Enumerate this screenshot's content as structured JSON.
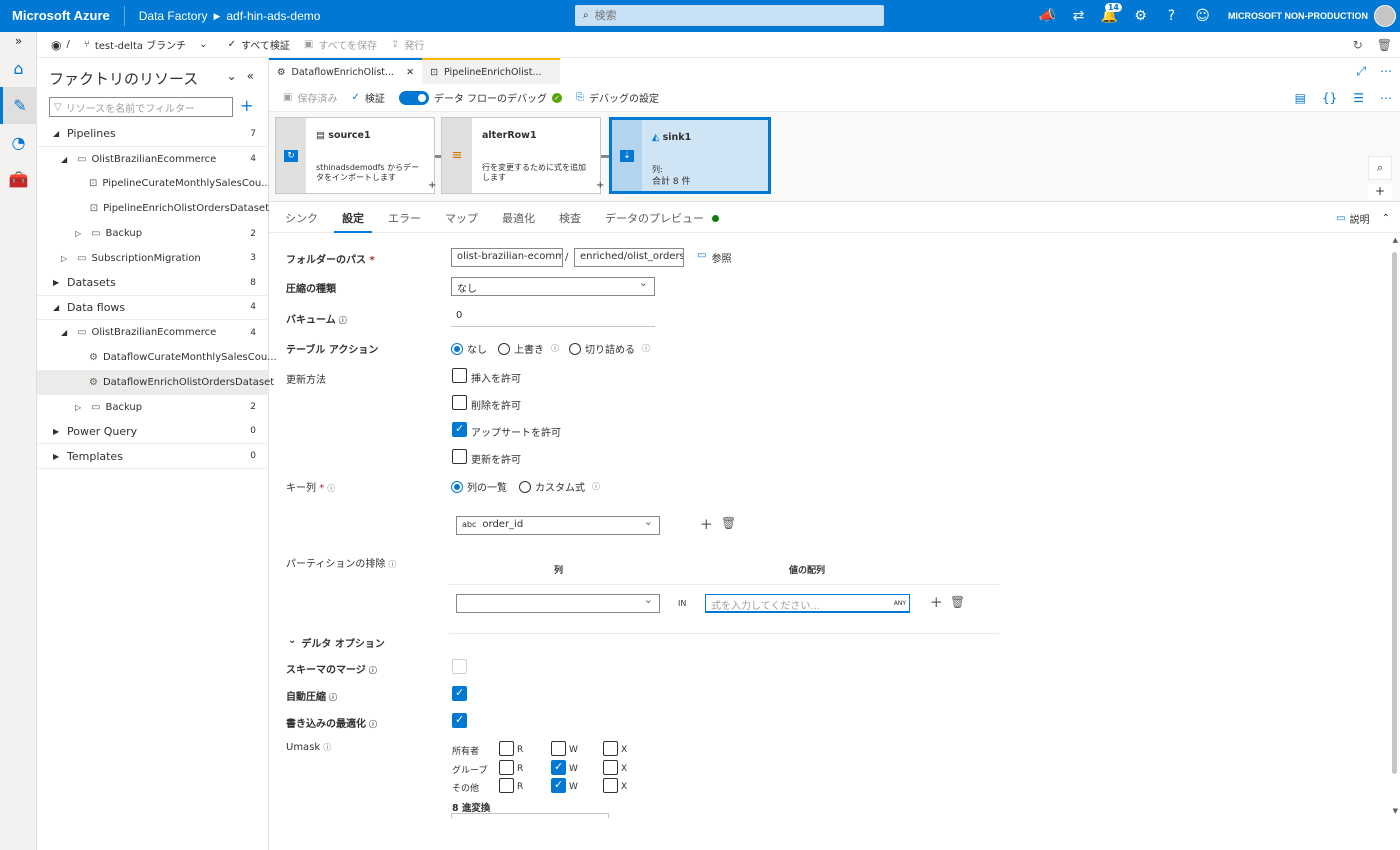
{
  "topbar": {
    "brand": "Microsoft Azure",
    "service": "Data Factory",
    "factory": "adf-hin-ads-demo",
    "search_placeholder": "検索",
    "notifications_count": "14",
    "account": "MICROSOFT NON-PRODUCTION"
  },
  "gitbar": {
    "sep": "/",
    "branch": "test-delta ブランチ",
    "validate_all": "すべて検証",
    "save_all": "すべてを保存",
    "publish": "発行"
  },
  "resources": {
    "title": "ファクトリのリソース",
    "filter_placeholder": "リソースを名前でフィルター",
    "tree": [
      {
        "label": "Pipelines",
        "count": "7",
        "kind": "top"
      },
      {
        "label": "OlistBrazilianEcommerce",
        "count": "4",
        "kind": "folder"
      },
      {
        "label": "PipelineCurateMonthlySalesCou...",
        "count": "",
        "kind": "pipeline"
      },
      {
        "label": "PipelineEnrichOlistOrdersDataset",
        "count": "",
        "kind": "pipeline"
      },
      {
        "label": "Backup",
        "count": "2",
        "kind": "subfolder"
      },
      {
        "label": "SubscriptionMigration",
        "count": "3",
        "kind": "folder2"
      },
      {
        "label": "Datasets",
        "count": "8",
        "kind": "top"
      },
      {
        "label": "Data flows",
        "count": "4",
        "kind": "top"
      },
      {
        "label": "OlistBrazilianEcommerce",
        "count": "4",
        "kind": "folder"
      },
      {
        "label": "DataflowCurateMonthlySalesCou...",
        "count": "",
        "kind": "dataflow"
      },
      {
        "label": "DataflowEnrichOlistOrdersDataset",
        "count": "",
        "kind": "dataflow-sel"
      },
      {
        "label": "Backup",
        "count": "2",
        "kind": "subfolder"
      },
      {
        "label": "Power Query",
        "count": "0",
        "kind": "top"
      },
      {
        "label": "Templates",
        "count": "0",
        "kind": "top"
      }
    ]
  },
  "editor": {
    "tab_active": "DataflowEnrichOlist...",
    "tab_inactive": "PipelineEnrichOlist...",
    "saved": "保存済み",
    "validate": "検証",
    "debug": "データ フローのデバッグ",
    "debug_settings": "デバッグの設定"
  },
  "canvas": {
    "nodes": [
      {
        "name": "source1",
        "desc": "sthinadsdemodfs からデータをインポートします"
      },
      {
        "name": "alterRow1",
        "desc": "行を変更するために式を追加します"
      },
      {
        "name": "sink1",
        "desc": "列:",
        "desc2": "合計 8 件"
      }
    ]
  },
  "settings_tabs": [
    "シンク",
    "設定",
    "エラー",
    "マップ",
    "最適化",
    "検査",
    "データのプレビュー"
  ],
  "settings_tabs_right": {
    "explain": "説明"
  },
  "form": {
    "folder_path_label": "フォルダーのパス",
    "folder_path_1": "olist-brazilian-ecomm",
    "folder_path_sep": "/",
    "folder_path_2": "enriched/olist_orders_",
    "browse": "参照",
    "compression_label": "圧縮の種類",
    "compression_value": "なし",
    "vacuum_label": "バキューム",
    "vacuum_value": "0",
    "table_action_label": "テーブル アクション",
    "table_action_options": [
      "なし",
      "上書き",
      "切り詰める"
    ],
    "update_method_label": "更新方法",
    "update_options": [
      "挿入を許可",
      "削除を許可",
      "アップサートを許可",
      "更新を許可"
    ],
    "key_columns_label": "キー列",
    "key_column_options": [
      "列の一覧",
      "カスタム式"
    ],
    "key_column_type": "abc",
    "key_column_value": "order_id",
    "partition_label": "パーティションの排除",
    "partition_col_header": "列",
    "partition_val_header": "値の配列",
    "partition_in": "IN",
    "partition_placeholder": "式を入力してください...",
    "partition_any": "ANY",
    "delta_options": "デルタ オプション",
    "merge_schema_label": "スキーマのマージ",
    "auto_compact_label": "自動圧縮",
    "optimize_write_label": "書き込みの最適化",
    "umask_label": "Umask",
    "umask_rows": [
      "所有者",
      "グループ",
      "その他"
    ],
    "umask_cols": [
      "R",
      "W",
      "X"
    ],
    "octal_label": "8 進変換"
  }
}
